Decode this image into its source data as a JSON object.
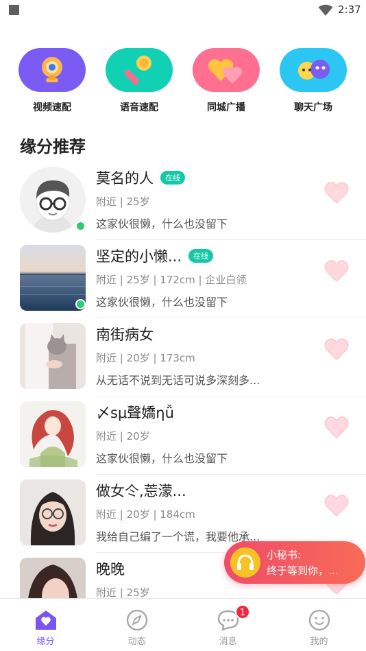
{
  "status_bar": {
    "time": "2:37"
  },
  "quick_entries": [
    {
      "label": "视频速配",
      "icon": "webcam-icon",
      "color": "#7a5cf5"
    },
    {
      "label": "语音速配",
      "icon": "microphone-icon",
      "color": "#12d0b4"
    },
    {
      "label": "同城广播",
      "icon": "hearts-icon",
      "color": "#ff6f8f"
    },
    {
      "label": "聊天广场",
      "icon": "chat-faces-icon",
      "color": "#2cc6f2"
    }
  ],
  "section_title": "缘分推荐",
  "users": [
    {
      "name": "莫名的人",
      "online_badge": "在线",
      "meta": "附近 | 25岁",
      "bio": "这家伙很懒，什么也没留下",
      "online": true,
      "avatar": "cartoon-glasses"
    },
    {
      "name": "坚定的小懒...",
      "online_badge": "在线",
      "meta": "附近 | 25岁 | 172cm | 企业白领",
      "bio": "这家伙很懒，什么也没留下",
      "online": true,
      "avatar": "sea-photo"
    },
    {
      "name": "南街病女",
      "online_badge": "",
      "meta": "附近 | 20岁 | 173cm",
      "bio": "从无话不说到无话可说多深刻多...",
      "online": false,
      "avatar": "cat-photo"
    },
    {
      "name": "〆sμ聲嬌ηǚ",
      "online_badge": "",
      "meta": "附近 | 20岁",
      "bio": "这家伙很懒，什么也没留下",
      "online": false,
      "avatar": "anime-girl"
    },
    {
      "name": "做女仒,莣濛...",
      "online_badge": "",
      "meta": "附近 | 20岁 | 184cm",
      "bio": "我给自己编了一个谎，我要他承...",
      "online": false,
      "avatar": "girl-glasses"
    },
    {
      "name": "晚晚",
      "online_badge": "",
      "meta": "附近 | 25岁",
      "bio": "",
      "online": false,
      "avatar": "girl-portrait"
    }
  ],
  "secretary": {
    "title": "小秘书:",
    "message": "终于等到你，..."
  },
  "tabs": [
    {
      "label": "缘分",
      "icon": "heart-house-icon",
      "active": true
    },
    {
      "label": "动态",
      "icon": "compass-icon",
      "active": false
    },
    {
      "label": "消息",
      "icon": "chat-bubble-icon",
      "active": false,
      "badge": "1"
    },
    {
      "label": "我的",
      "icon": "smiley-icon",
      "active": false
    }
  ],
  "colors": {
    "accent": "#7b55f0",
    "online": "#2ecc71",
    "badge": "#16c9a5",
    "heart": "#ffd3da"
  }
}
